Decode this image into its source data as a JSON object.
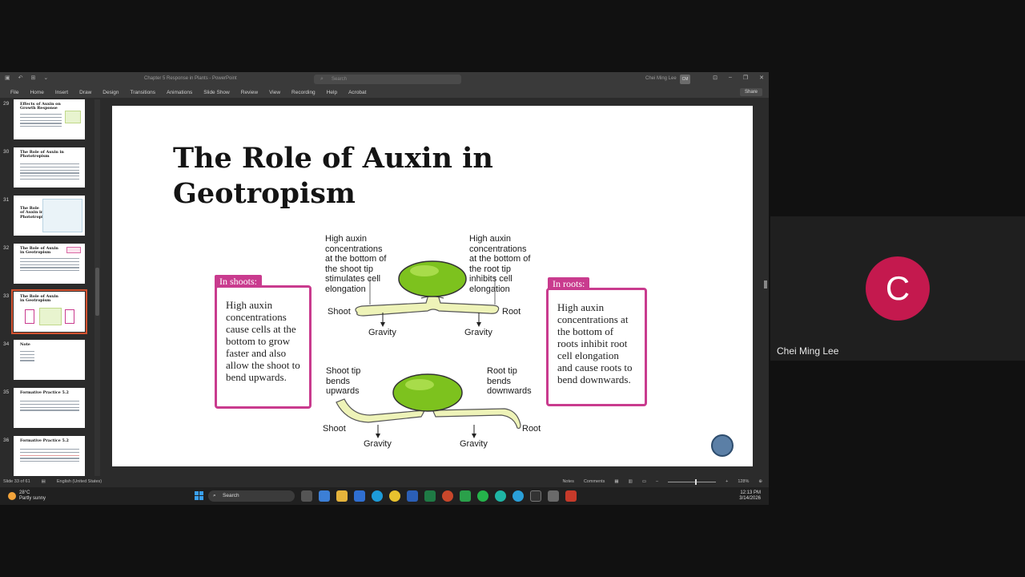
{
  "window": {
    "doc_title": "Chapter 5 Response in Plants - PowerPoint",
    "search_placeholder": "Search",
    "user_name": "Chei Ming Lee",
    "user_initials": "CM"
  },
  "menu": {
    "tabs": [
      "File",
      "Home",
      "Insert",
      "Draw",
      "Design",
      "Transitions",
      "Animations",
      "Slide Show",
      "Review",
      "View",
      "Recording",
      "Help",
      "Acrobat"
    ],
    "share_label": "Share"
  },
  "thumbnails": [
    {
      "num": "29",
      "title": "Effects of Auxin on Growth Response"
    },
    {
      "num": "30",
      "title": "The Role of Auxin in Phototropism"
    },
    {
      "num": "31",
      "title": "The Role of Auxin in Phototropism"
    },
    {
      "num": "32",
      "title": "The Role of Auxin in Geotropism"
    },
    {
      "num": "33",
      "title": "The Role of Auxin in Geotropism"
    },
    {
      "num": "34",
      "title": "Note"
    },
    {
      "num": "35",
      "title": "Formative Practice 5.2"
    },
    {
      "num": "36",
      "title": "Formative Practice 5.2"
    }
  ],
  "active_thumb": "33",
  "slide": {
    "title_line1": "The Role of Auxin in",
    "title_line2": "Geotropism",
    "shoots_tag": "In shoots:",
    "shoots_text": "High auxin concentrations cause cells at the bottom to grow faster and also allow the shoot to bend upwards.",
    "roots_tag": "In roots:",
    "roots_text": "High auxin concentrations at the bottom of roots inhibit root cell elongation and cause roots to bend downwards.",
    "diagram": {
      "top_left": "High auxin concentrations at the bottom of the shoot tip stimulates cell elongation",
      "top_right": "High auxin concentrations at the bottom of the root tip inhibits cell elongation",
      "shoot": "Shoot",
      "root": "Root",
      "gravity": "Gravity",
      "bottom_left": "Shoot tip bends upwards",
      "bottom_right": "Root tip bends downwards"
    }
  },
  "status": {
    "slide_count": "Slide 33 of 61",
    "language": "English (United States)",
    "notes": "Notes",
    "comments": "Comments",
    "zoom": "128%"
  },
  "taskbar": {
    "temp": "28°C",
    "weather": "Partly sunny",
    "search": "Search",
    "time": "12:13 PM",
    "date": "3/14/2026"
  },
  "participant": {
    "initial": "C",
    "name": "Chei Ming Lee"
  },
  "colors": {
    "accent_magenta": "#c93b8e",
    "seedling_green": "#7dc21e",
    "avatar_red": "#c4194e"
  }
}
